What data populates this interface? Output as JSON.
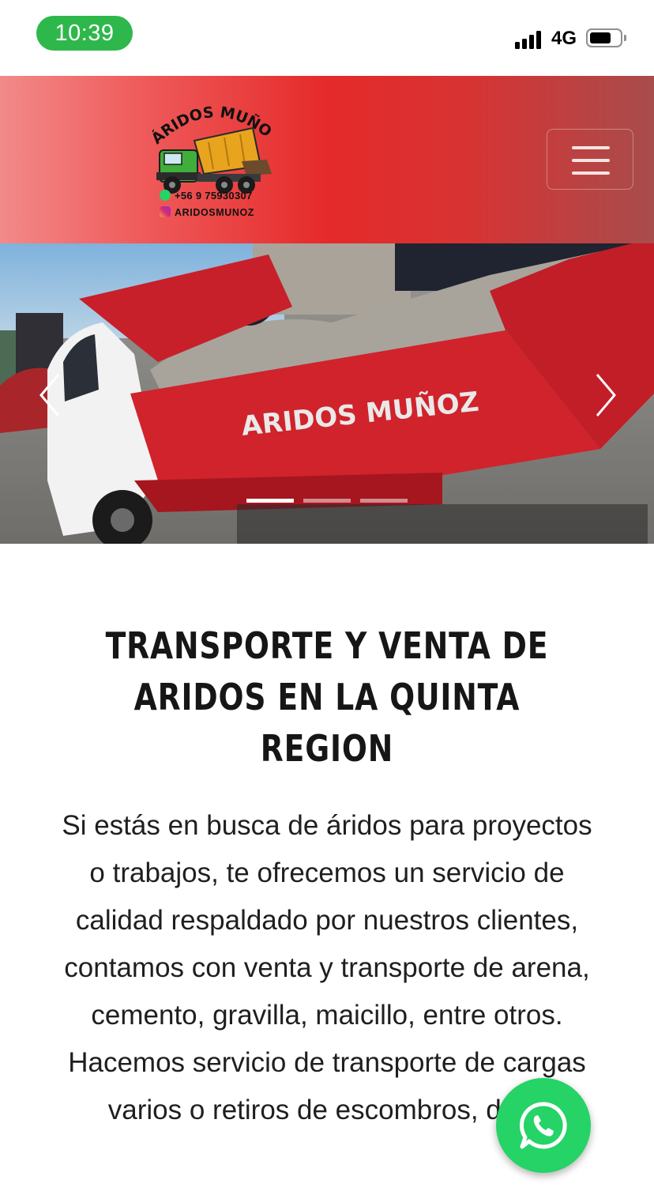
{
  "status_bar": {
    "time": "10:39",
    "network": "4G",
    "battery_level": 0.65
  },
  "header": {
    "logo": {
      "brand_text": "ÁRIDOS MUÑOZ",
      "phone": "+56 9 75930307",
      "instagram": "ARIDOSMUNOZ"
    },
    "menu_icon": "hamburger-icon"
  },
  "hero": {
    "truck_lettering": "ARIDOS MUÑOZ",
    "prev_icon": "chevron-left-icon",
    "next_icon": "chevron-right-icon",
    "slide_count": 3,
    "active_slide": 1
  },
  "main": {
    "title": "TRANSPORTE Y VENTA DE ARIDOS EN LA QUINTA REGION",
    "description": "Si estás en busca de áridos para proyectos o trabajos, te ofrecemos un servicio de calidad respaldado por nuestros clientes, contamos con venta y transporte de arena, cemento, gravilla, maicillo, entre otros. Hacemos servicio de transporte de cargas varios o retiros de escombros, de lo"
  },
  "whatsapp": {
    "icon": "whatsapp-icon",
    "color": "#25d366"
  },
  "colors": {
    "header_red": "#e52a2a",
    "status_green": "#2eb84b"
  }
}
